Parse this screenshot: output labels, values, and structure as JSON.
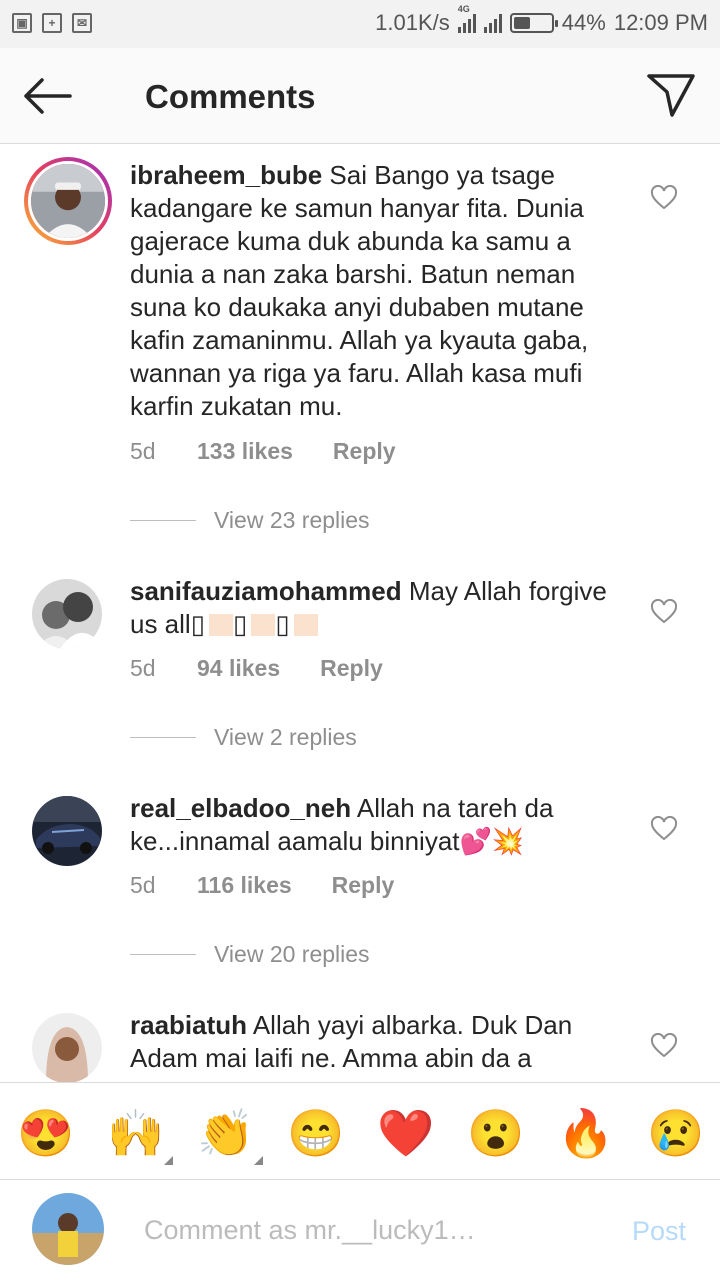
{
  "status_bar": {
    "speed": "1.01K/s",
    "network": "4G",
    "battery": "44%",
    "battery_level": 0.44,
    "time": "12:09 PM",
    "icons": [
      "gallery-icon",
      "sim-icon",
      "mail-icon",
      "signal-icon",
      "battery-icon"
    ]
  },
  "header": {
    "title": "Comments",
    "back_icon": "arrow-left-icon",
    "share_icon": "paper-plane-icon"
  },
  "comments": [
    {
      "username": "ibraheem_bube",
      "text": "Sai Bango ya tsage kadangare ke samun hanyar fita. Dunia gajerace kuma duk abunda ka samu a dunia a nan zaka barshi. Batun neman suna ko daukaka anyi dubaben mutane kafin zamaninmu. Allah ya kyauta gaba, wannan ya riga ya faru. Allah kasa mufi karfin zukatan mu.",
      "time": "5d",
      "likes": "133 likes",
      "reply": "Reply",
      "view_replies": "View 23 replies",
      "has_story_ring": true
    },
    {
      "username": "sanifauziamohammed",
      "text": "May Allah forgive us all",
      "text_suffix_glyph": "▯",
      "time": "5d",
      "likes": "94 likes",
      "reply": "Reply",
      "view_replies": "View 2 replies",
      "has_story_ring": false
    },
    {
      "username": "real_elbadoo_neh",
      "text": "Allah na tareh da ke...innamal aamalu binniyat",
      "emoji": "💕💥",
      "time": "5d",
      "likes": "116 likes",
      "reply": "Reply",
      "view_replies": "View 20 replies",
      "has_story_ring": false
    },
    {
      "username": "raabiatuh",
      "text": "Allah yayi albarka. Duk Dan Adam mai laifi ne. Amma abin da a",
      "has_story_ring": false
    }
  ],
  "emoji_bar": [
    "😍",
    "🙌",
    "👏",
    "😁",
    "❤️",
    "😮",
    "🔥",
    "😢"
  ],
  "composer": {
    "placeholder": "Comment as mr.__lucky1…",
    "post_label": "Post"
  },
  "colors": {
    "text": "#262626",
    "muted": "#8e8e8e",
    "post_disabled": "#b6dafa",
    "divider": "#dbdbdb"
  }
}
